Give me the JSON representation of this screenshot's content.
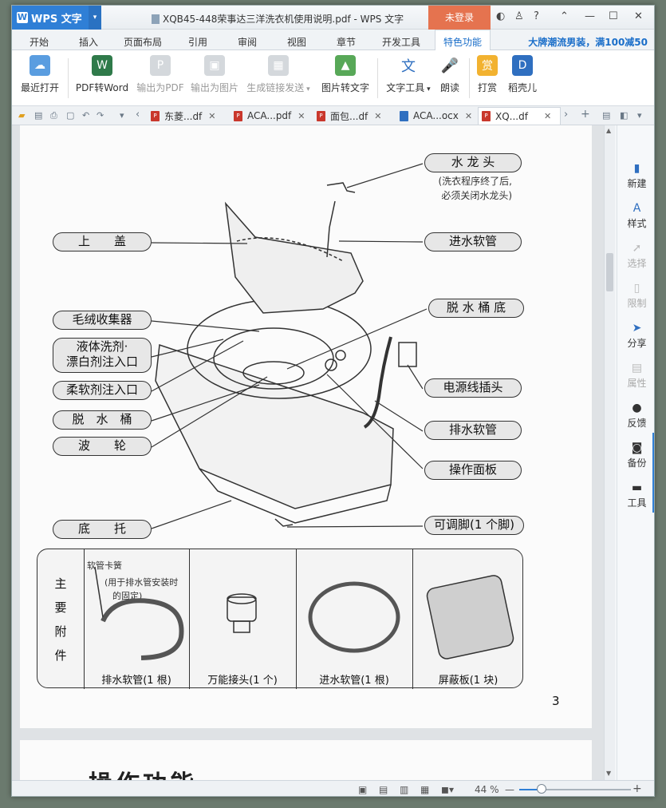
{
  "app": {
    "name": "WPS 文字",
    "title": "XQB45-448荣事达三洋洗衣机使用说明.pdf - WPS 文字",
    "login": "未登录",
    "help": "?",
    "promo": "大牌潮流男装，满100减50"
  },
  "menus": [
    "开始",
    "插入",
    "页面布局",
    "引用",
    "审阅",
    "视图",
    "章节",
    "开发工具",
    "特色功能"
  ],
  "ribbon": {
    "recent": "最近打开",
    "pdf2word": "PDF转Word",
    "export_pdf": "输出为PDF",
    "export_img": "输出为图片",
    "share_link": "生成链接发送",
    "img2text": "图片转文字",
    "text_tools": "文字工具",
    "read": "朗读",
    "reward": "打赏",
    "daoke": "稻壳儿"
  },
  "tabs": [
    "东菱...df",
    "ACA...pdf",
    "面包...df",
    "ACA...ocx",
    "XQ...df"
  ],
  "side": [
    "新建",
    "样式",
    "选择",
    "限制",
    "分享",
    "属性",
    "反馈",
    "备份",
    "工具"
  ],
  "status": {
    "zoom": "44 %",
    "zoom_value": 0.2
  },
  "doc": {
    "labels": {
      "faucet": "水 龙 头",
      "faucet_note1": "(洗衣程序终了后,",
      "faucet_note2": "必须关闭水龙头)",
      "lid": "上　　盖",
      "inlet": "进水软管",
      "lint": "毛绒收集器",
      "tub_bottom": "脱 水 桶 底",
      "detergent1": "液体洗剂·",
      "detergent2": "漂白剂注入口",
      "plug": "电源线插头",
      "softener": "柔软剂注入口",
      "spin_tub": "脱　水　桶",
      "drain": "排水软管",
      "pulsator": "波　　轮",
      "panel": "操作面板",
      "base": "底　　托",
      "foot": "可调脚(1 个脚)"
    },
    "accessories": {
      "title": [
        "主",
        "要",
        "附",
        "件"
      ],
      "clip": "软管卡簧",
      "clip_note1": "(用于排水管安装时",
      "clip_note2": "的固定)",
      "items": [
        "排水软管(1 根)",
        "万能接头(1 个)",
        "进水软管(1 根)",
        "屏蔽板(1 块)"
      ]
    },
    "page_number": "3",
    "next_heading": "操作功能"
  }
}
